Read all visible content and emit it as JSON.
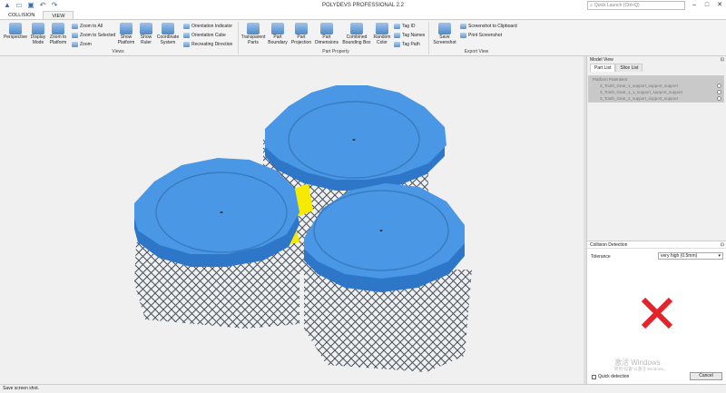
{
  "title": "POLYDEVS PROFESSIONAL 2.2",
  "search": {
    "placeholder": "Quick Launch (Ctrl+Q)"
  },
  "tabs": [
    "COLLISION",
    "VIEW"
  ],
  "ribbon": {
    "perspective": "Perspective",
    "display_mode": "Display Mode",
    "zoom_platform": "Zoom to Platform",
    "zoom_all": "Zoom to All",
    "zoom_selected": "Zoom to Selected",
    "zoom": "Zoom",
    "show_platform": "Show Platform",
    "show_ruler": "Show Ruler",
    "coordinate_system": "Coordinate System",
    "orientation_indicator": "Orientation Indicator",
    "orientation_cube": "Orientation Cube",
    "recreating_direction": "Recreating Direction",
    "views_group": "Views",
    "transparent_parts": "Transparent Parts",
    "part_boundary": "Part Boundary",
    "part_projection": "Part Projection",
    "part_dimensions": "Part Dimensions",
    "combined_bbox": "Combined Bounding Box",
    "random_color": "Random Color",
    "tag_id": "Tag ID",
    "tag_names": "Tag Names",
    "tag_path": "Tag Path",
    "part_property_group": "Part Property",
    "save_screenshot": "Save Screenshot",
    "screenshot_clipboard": "Screenshot to Clipboard",
    "print_screenshot": "Print Screenshot",
    "export_group": "Export View"
  },
  "model_view": {
    "title": "Model View",
    "tabs": [
      "Part List",
      "Slice List"
    ],
    "rows": [
      "Platform Patentient",
      "3_Tooth_Gear_1_support_support_support",
      "3_Tooth_Gear_1_1_support_support_support",
      "3_Tooth_Gear_2_support_support_support"
    ]
  },
  "collision": {
    "title": "Collision Detection",
    "tolerance_label": "Tolerance",
    "tolerance_value": "very high (0.5mm)",
    "quick_detection": "Quick detection",
    "cancel": "Cancel",
    "watermark": "激活 Windows",
    "watermark2": "转到\"设置\"以激活 Windows。"
  },
  "status": "Save screen shot.",
  "colors": {
    "gear_top": "#4a97e6",
    "gear_side": "#2e77c8",
    "collision": "#f5ea00",
    "error": "#e3242b"
  }
}
